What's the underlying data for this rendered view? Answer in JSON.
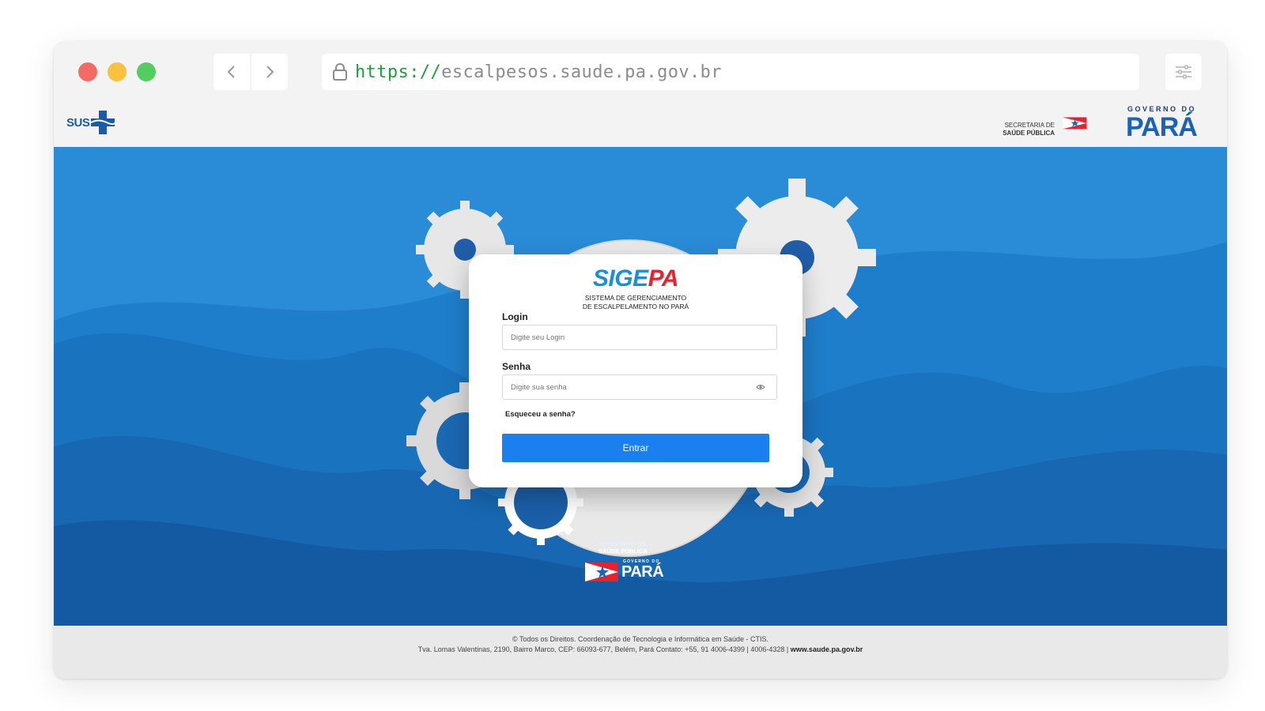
{
  "browser": {
    "url_scheme": "https://",
    "url_host": "escalpesos.saude.pa.gov.br"
  },
  "header": {
    "sus_logo_text": "SUS",
    "secretaria_line1": "SECRETARIA DE",
    "secretaria_line2": "SAÚDE PÚBLICA",
    "gov_label": "GOVERNO DO",
    "para_label": "PARÁ"
  },
  "login": {
    "brand_part1": "SIGE",
    "brand_part2": "PA",
    "subtitle_line1": "SISTEMA DE GERENCIAMENTO",
    "subtitle_line2": "DE ESCALPELAMENTO NO PARÁ",
    "login_label": "Login",
    "login_placeholder": "Digite seu Login",
    "senha_label": "Senha",
    "senha_placeholder": "Digite sua senha",
    "forgot_link": "Esqueceu a senha?",
    "submit_label": "Entrar"
  },
  "bottom_logo": {
    "line1": "SECRETARIA DE",
    "line2": "SAÚDE PÚBLICA",
    "gov_label": "GOVERNO DO",
    "para_label": "PARÁ"
  },
  "footer": {
    "line1": "© Todos os Direitos. Coordenação de Tecnologia e Informática em Saúde - CTIS.",
    "line2": "Tva. Lomas Valentinas, 2190, Bairro Marco, CEP: 66093-677, Belém, Pará Contato: +55, 91 4006-4399 | 4006-4328 |",
    "website": "www.saude.pa.gov.br"
  },
  "colors": {
    "hero_blue": "#1f7ecb",
    "brand_blue": "#1a8fd7",
    "brand_red": "#e4232f",
    "button_blue": "#1a80f0"
  }
}
